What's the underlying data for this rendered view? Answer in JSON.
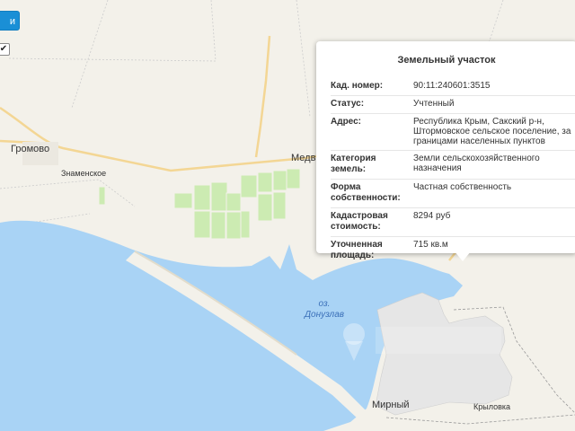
{
  "controls": {
    "top_button_label": "и",
    "checkbox_mark": "✔"
  },
  "places": {
    "gromovo": "Громово",
    "znamenskoe": "Знаменское",
    "medv": "Медв",
    "mirny": "Мирный",
    "krylovka": "Крыловка"
  },
  "water": {
    "lake_prefix": "оз.",
    "lake_name": "Донузлав"
  },
  "popup": {
    "title": "Земельный участок",
    "rows": [
      {
        "key": "Кад. номер:",
        "value": "90:11:240601:3515"
      },
      {
        "key": "Статус:",
        "value": "Учтенный"
      },
      {
        "key": "Адрес:",
        "value": "Республика Крым, Сакский р-н, Штормовское сельское поселение, за границами населенных пунктов"
      },
      {
        "key": "Категория земель:",
        "value": "Земли сельскохозяйственного назначения"
      },
      {
        "key": "Форма собственности:",
        "value": "Частная собственность"
      },
      {
        "key": "Кадастровая стоимость:",
        "value": "8294 руб"
      },
      {
        "key": "Уточненная площадь:",
        "value": "715 кв.м"
      }
    ]
  },
  "colors": {
    "water": "#a9d3f5",
    "land": "#f3f1ea",
    "parcels": "#ccebb2",
    "settlement": "#e6e6e6",
    "roads": "#f3d694"
  }
}
